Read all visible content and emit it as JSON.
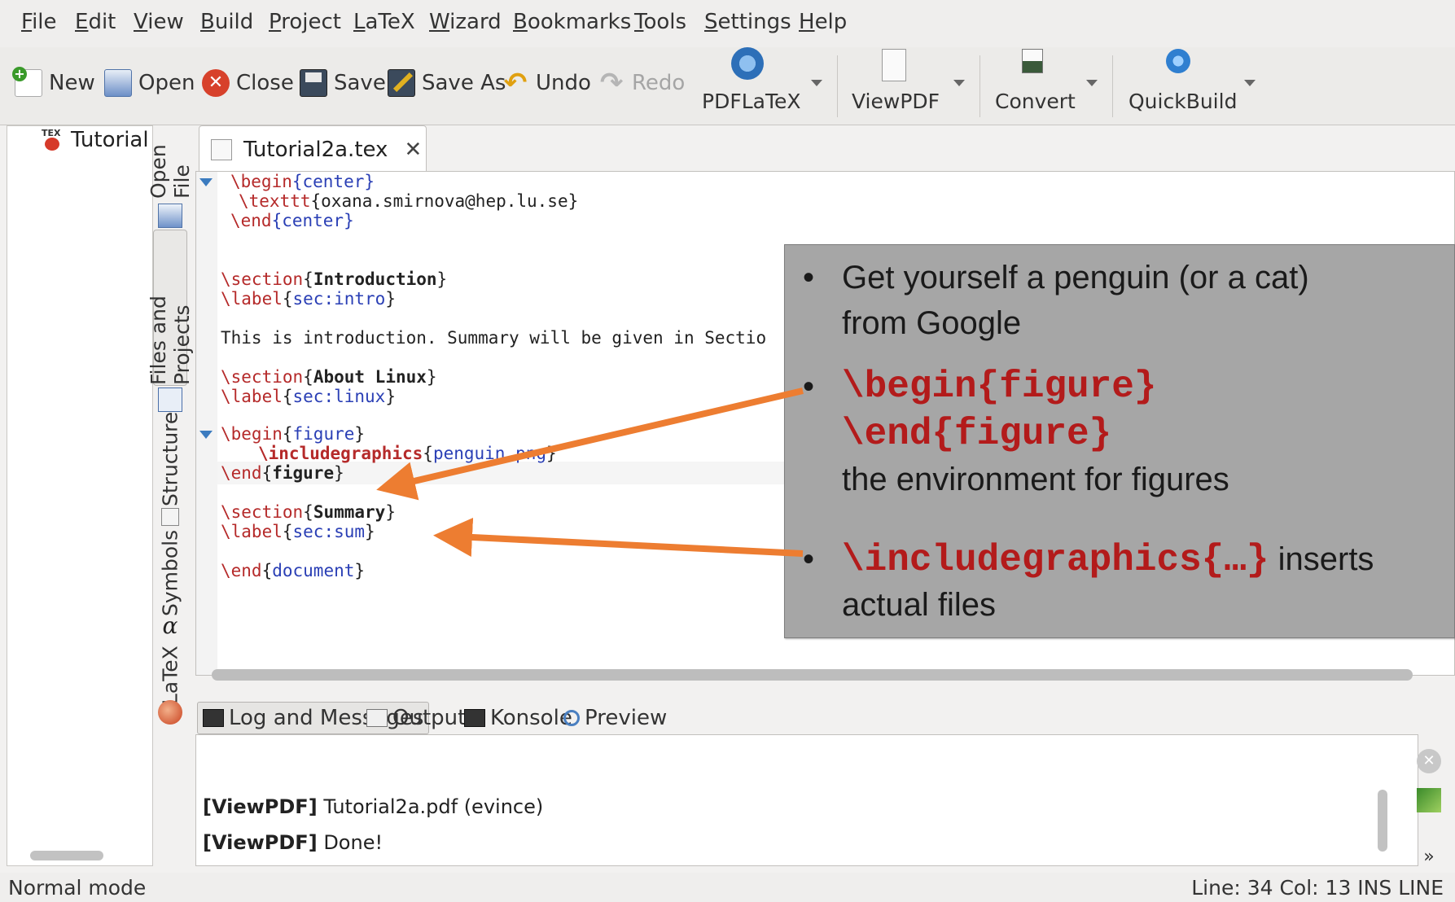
{
  "menubar": {
    "items": [
      "File",
      "Edit",
      "View",
      "Build",
      "Project",
      "LaTeX",
      "Wizard",
      "Bookmarks",
      "Tools",
      "Settings",
      "Help"
    ]
  },
  "toolbar": {
    "new": "New",
    "open": "Open",
    "close": "Close",
    "save": "Save",
    "save_as": "Save As",
    "undo": "Undo",
    "redo": "Redo",
    "pdflatex": "PDFLaTeX",
    "viewpdf": "ViewPDF",
    "convert": "Convert",
    "quickbuild": "QuickBuild"
  },
  "sidepanel": {
    "tree_item": "Tutorial",
    "vtabs": [
      "Open File",
      "Files and Projects",
      "Structure",
      "Symbols",
      "LaTeX"
    ]
  },
  "editor": {
    "tab_title": "Tutorial2a.tex",
    "close_glyph": "✕",
    "lines": {
      "l1_cmd": "\\begin",
      "l1_arg": "{center}",
      "l2_cmd": "\\texttt",
      "l2_arg": "{oxana.smirnova@hep.lu.se}",
      "l3_cmd": "\\end",
      "l3_arg": "{center}",
      "l4_cmd": "\\section",
      "l4_arg": "Introduction",
      "l5_cmd": "\\label",
      "l5_arg": "sec:intro",
      "l6_text": "This is introduction. Summary will be given in Sectio",
      "l7_cmd": "\\section",
      "l7_arg": "About Linux",
      "l8_cmd": "\\label",
      "l8_arg": "sec:linux",
      "l9_cmd": "\\begin",
      "l9_arg": "figure",
      "l10_cmd": "\\includegraphics",
      "l10_arg": "penguin.png",
      "l11_cmd": "\\end",
      "l11_arg": "figure",
      "l12_cmd": "\\section",
      "l12_arg": "Summary",
      "l13_cmd": "\\label",
      "l13_arg": "sec:sum",
      "l14_cmd": "\\end",
      "l14_arg": "document"
    }
  },
  "dock": {
    "tabs": [
      "Log and Messages",
      "Output",
      "Konsole",
      "Preview"
    ],
    "log": [
      {
        "tag": "[ViewPDF]",
        "text": "Tutorial2a.pdf (evince)"
      },
      {
        "tag": "[ViewPDF]",
        "text": "Done!"
      }
    ]
  },
  "statusbar": {
    "mode": "Normal mode",
    "position": "Line: 34 Col: 13  INS  LINE"
  },
  "callout": {
    "b1_line1": "Get yourself a penguin (or a cat)",
    "b1_line2": "from Google",
    "b2_code1": "\\begin{figure}",
    "b2_code2": "\\end{figure}",
    "b2_text": "the environment for figures",
    "b3_code": "\\includegraphics{…}",
    "b3_text1": " inserts",
    "b3_text2": "actual files",
    "bullet_glyph": "•"
  },
  "colors": {
    "command_red": "#b52a2a",
    "argument_blue": "#2a3fb5",
    "arrow_orange": "#ed7d31",
    "callout_grey": "#a6a6a6"
  }
}
